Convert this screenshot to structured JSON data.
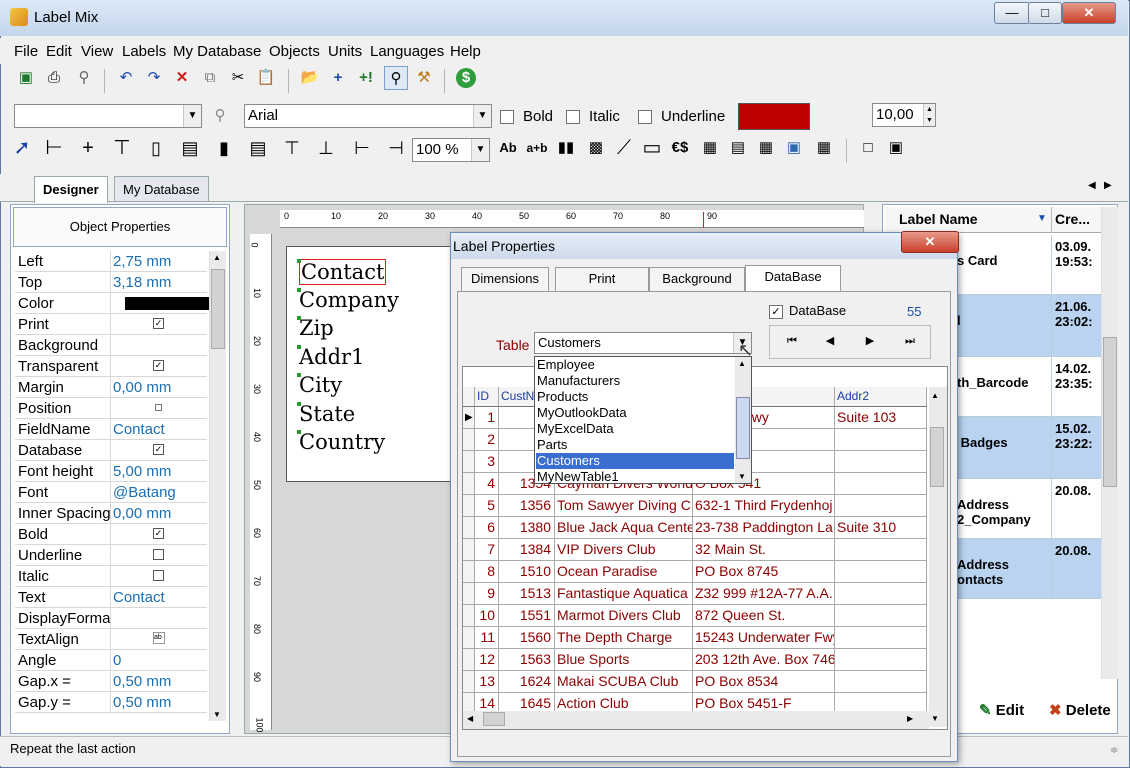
{
  "window": {
    "title": "Label Mix"
  },
  "menu": [
    "File",
    "Edit",
    "View",
    "Labels",
    "My Database",
    "Objects",
    "Units",
    "Languages",
    "Help"
  ],
  "font_toolbar": {
    "font": "Arial",
    "bold": "Bold",
    "italic": "Italic",
    "underline": "Underline",
    "size": "10,00",
    "color": "#c00000"
  },
  "zoom": "100 %",
  "draw_toolbar_text": {
    "abc": "Ab",
    "aplusb": "a+b",
    "currency": "€$"
  },
  "tabs": {
    "designer": "Designer",
    "mydb": "My Database"
  },
  "left": {
    "header": "Object Properties",
    "props": [
      {
        "n": "Left",
        "v": "2,75 mm"
      },
      {
        "n": "Top",
        "v": "3,18 mm"
      },
      {
        "n": "Color",
        "v": ""
      },
      {
        "n": "Print",
        "chk": true
      },
      {
        "n": "Background",
        "v": ""
      },
      {
        "n": "Transparent",
        "chk": true
      },
      {
        "n": "Margin",
        "v": "0,00 mm"
      },
      {
        "n": "Position",
        "v": ""
      },
      {
        "n": "FieldName",
        "v": "Contact"
      },
      {
        "n": "Database",
        "chk": true
      },
      {
        "n": "Font height",
        "v": "5,00 mm"
      },
      {
        "n": "Font",
        "v": "@Batang"
      },
      {
        "n": "Inner Spacing",
        "v": "0,00 mm"
      },
      {
        "n": "Bold",
        "chk": true
      },
      {
        "n": "Underline",
        "chk": false
      },
      {
        "n": "Italic",
        "chk": false
      },
      {
        "n": "Text",
        "v": "Contact"
      },
      {
        "n": "DisplayFormat",
        "v": ""
      },
      {
        "n": "TextAlign",
        "v": ""
      },
      {
        "n": "Angle",
        "v": "0"
      },
      {
        "n": "Gap.x =",
        "v": "0,50 mm"
      },
      {
        "n": "Gap.y =",
        "v": "0,50 mm"
      }
    ]
  },
  "label_fields": [
    "Contact",
    "Company",
    "Zip",
    "Addr1",
    "City",
    "State",
    "Country"
  ],
  "ruler_h": [
    "0",
    "10",
    "20",
    "30",
    "40",
    "50",
    "60",
    "70",
    "80",
    "90"
  ],
  "ruler_v": [
    "0",
    "10",
    "20",
    "30",
    "40",
    "50",
    "60",
    "70",
    "80",
    "90",
    "100"
  ],
  "right": {
    "col_name": "Label Name",
    "col_created": "Cre...",
    "rows": [
      {
        "name": "s Card",
        "created": "03.09.\n19:53:"
      },
      {
        "name": "l",
        "created": "21.06.\n23:02:"
      },
      {
        "name": "th_Barcode",
        "created": "14.02.\n23:35:"
      },
      {
        "name": " Badges",
        "created": "15.02.\n23:22:"
      },
      {
        "name": "Address\n2_Company",
        "created": "20.08."
      },
      {
        "name": "Address\nontacts",
        "created": "20.08."
      }
    ],
    "edit": "Edit",
    "delete": "Delete"
  },
  "status": "Repeat the last action",
  "dialog": {
    "title": "Label Properties",
    "tabs": [
      "Dimensions",
      "Print",
      "Background",
      "DataBase"
    ],
    "database_label": "DataBase",
    "record_count": "55",
    "table_label": "Table",
    "table_value": "Customers",
    "dropdown": [
      "Employee",
      "Manufacturers",
      "Products",
      "MyOutlookData",
      "MyExcelData",
      "Parts",
      "Customers",
      "MyNewTable1"
    ],
    "grid_headers": [
      "ID",
      "CustN",
      "",
      "Addr2"
    ],
    "grid_rows": [
      [
        "1",
        "12",
        "",
        "garloaf Hwy",
        "Suite 103"
      ],
      [
        "2",
        "12",
        "",
        "Z-547",
        ""
      ],
      [
        "3",
        "13",
        "",
        "e Lane",
        ""
      ],
      [
        "4",
        "1354",
        "Cayman Divers World",
        "O Box 541",
        ""
      ],
      [
        "5",
        "1356",
        "Tom Sawyer Diving C",
        "632-1 Third Frydenhoj",
        ""
      ],
      [
        "6",
        "1380",
        "Blue Jack Aqua Center",
        "23-738 Paddington La",
        "Suite 310"
      ],
      [
        "7",
        "1384",
        "VIP Divers Club",
        "32 Main St.",
        ""
      ],
      [
        "8",
        "1510",
        "Ocean Paradise",
        "PO Box 8745",
        ""
      ],
      [
        "9",
        "1513",
        "Fantastique Aquatica",
        "Z32 999 #12A-77 A.A.",
        ""
      ],
      [
        "10",
        "1551",
        "Marmot Divers Club",
        "872 Queen St.",
        ""
      ],
      [
        "11",
        "1560",
        "The Depth Charge",
        "15243 Underwater Fwy",
        ""
      ],
      [
        "12",
        "1563",
        "Blue Sports",
        "203 12th Ave. Box 746",
        ""
      ],
      [
        "13",
        "1624",
        "Makai SCUBA Club",
        "PO Box 8534",
        ""
      ],
      [
        "14",
        "1645",
        "Action Club",
        "PO Box 5451-F",
        ""
      ]
    ]
  }
}
